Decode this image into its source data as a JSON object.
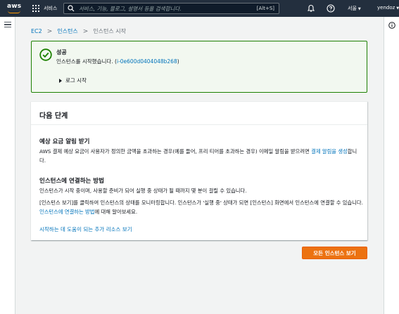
{
  "topnav": {
    "logo_text": "aws",
    "services_label": "서비스",
    "search_placeholder": "서비스, 기능, 블로그, 설명서 등을 검색합니다.",
    "search_shortcut": "[Alt+S]",
    "region": "서울",
    "user": "yendoz"
  },
  "breadcrumb": {
    "items": [
      "EC2",
      "인스턴스",
      "인스턴스 시작"
    ],
    "separator": ">"
  },
  "success": {
    "title": "성공",
    "message_prefix": "인스턴스를 시작했습니다. (",
    "instance_id": "i-0e600d0404048b268",
    "message_suffix": ")",
    "log_label": "로그 시작"
  },
  "next_steps": {
    "heading": "다음 단계",
    "billing": {
      "title": "예상 요금 알림 받기",
      "text": "AWS 결제 예상 요금이 사용자가 정의한 금액을 초과하는 경우(예를 들어, 프리 티어를 초과하는 경우) 이메일 알림을 받으려면 ",
      "link": "결제 알림을 생성",
      "text_end": "합니다."
    },
    "connect": {
      "title": "인스턴스에 연결하는 방법",
      "para1": "인스턴스가 시작 중이며, 사용할 준비가 되어 실행 중 상태가 될 때까지 몇 분이 걸릴 수 있습니다.",
      "para2": "[인스턴스 보기]를 클릭하여 인스턴스의 상태를 모니터링합니다. 인스턴스가 '실행 중' 상태가 되면 [인스턴스] 화면에서 인스턴스에 연결할 수 있습니다. ",
      "para2_link": "인스턴스에 연결하는 방법",
      "para2_end": "에 대해 알아보세요."
    },
    "more_link": "시작하는 데 도움이 되는 추가 리소스 보기"
  },
  "view_all_button": "모든 인스턴스 보기",
  "colors": {
    "nav_bg": "#232f3e",
    "accent": "#ec7211",
    "success": "#1d8102",
    "link": "#0073bb"
  }
}
